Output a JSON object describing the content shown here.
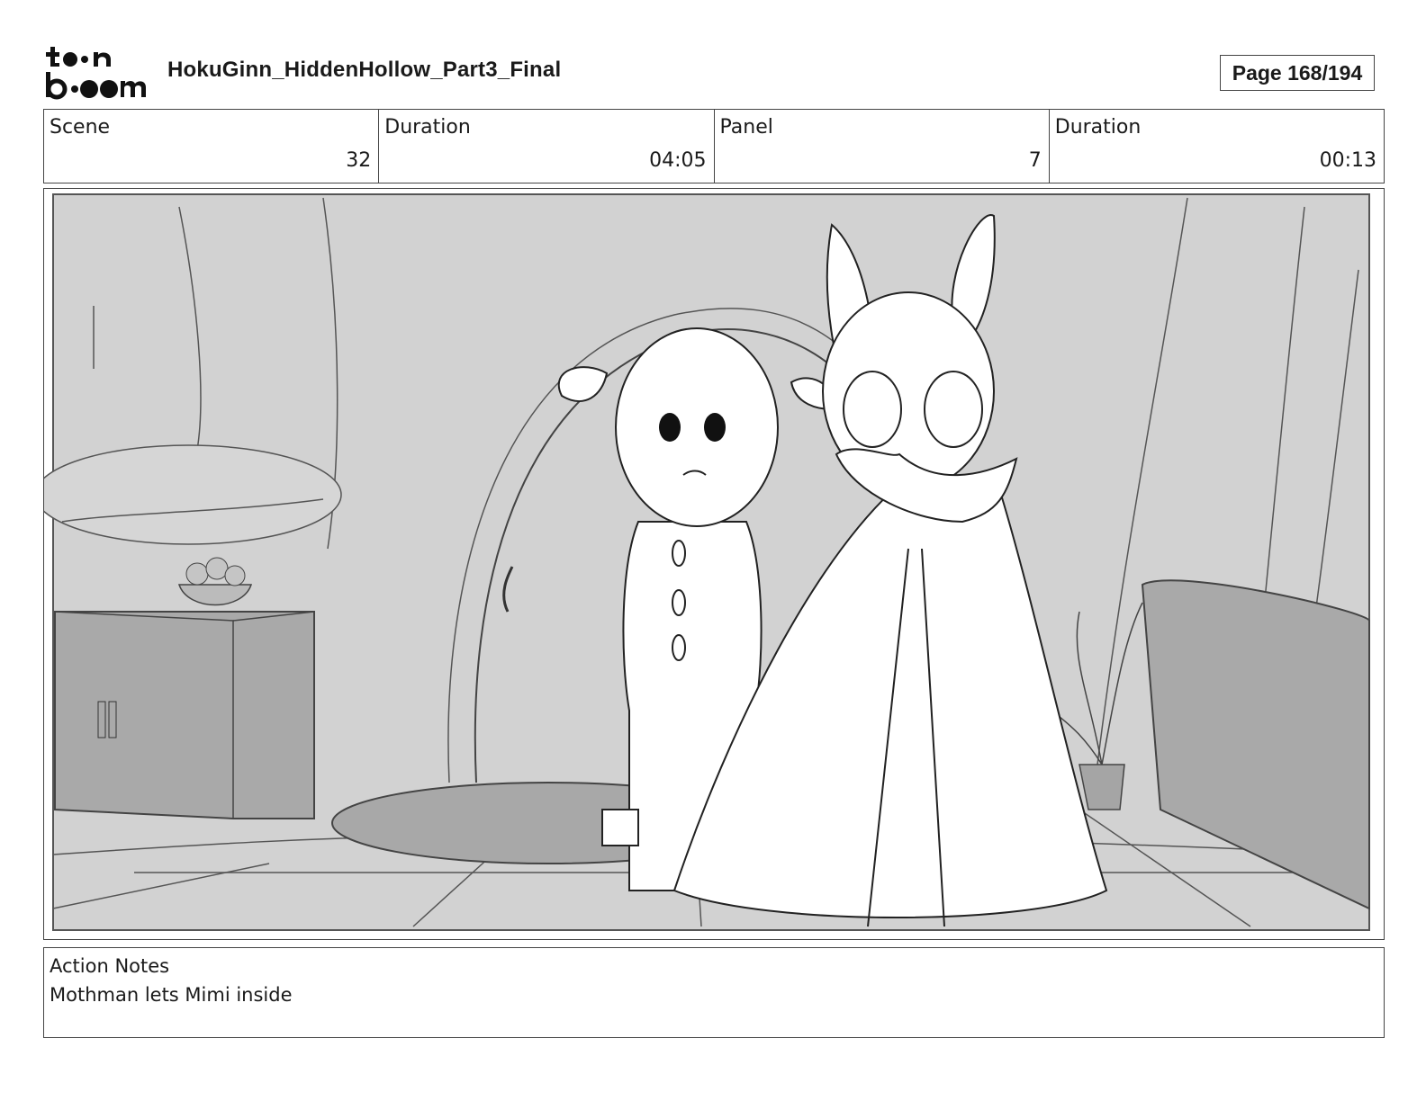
{
  "header": {
    "brand_logo": "toon-boom-logo",
    "document_title": "HokuGinn_HiddenHollow_Part3_Final",
    "page_indicator": "Page 168/194"
  },
  "info": {
    "scene_label": "Scene",
    "scene_value": "32",
    "scene_duration_label": "Duration",
    "scene_duration_value": "04:05",
    "panel_label": "Panel",
    "panel_value": "7",
    "panel_duration_label": "Duration",
    "panel_duration_value": "00:13"
  },
  "panel": {
    "image": "storyboard-sketch"
  },
  "notes": {
    "label": "Action Notes",
    "text": "Mothman lets Mimi inside"
  }
}
